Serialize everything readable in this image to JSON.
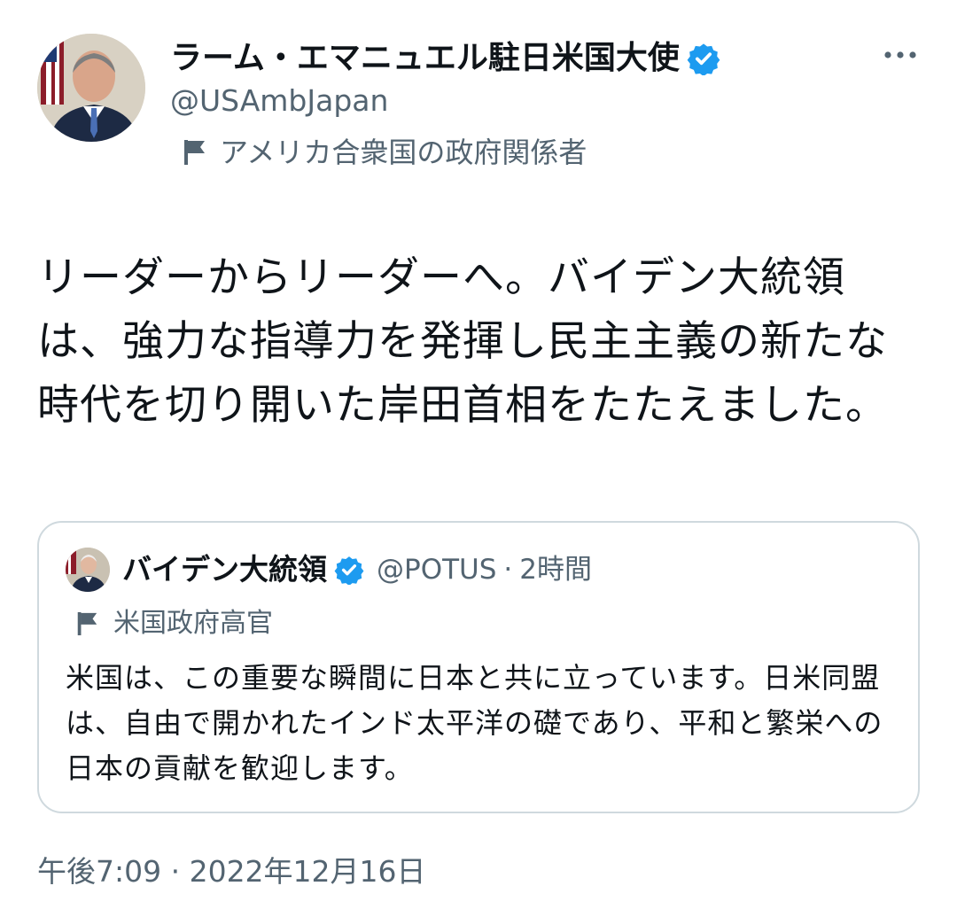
{
  "author": {
    "name": "ラーム・エマニュエル駐日米国大使",
    "handle": "@USAmbJapan",
    "label": "アメリカ合衆国の政府関係者",
    "verified_color": "#1d9bf0"
  },
  "tweet": {
    "text": "リーダーからリーダーへ。バイデン大統領は、強力な指導力を発揮し民主主義の新たな時代を切り開いた岸田首相をたたえました。"
  },
  "quote": {
    "name": "バイデン大統領",
    "handle": "@POTUS",
    "separator": "·",
    "time": "2時間",
    "label": "米国政府高官",
    "text": "米国は、この重要な瞬間に日本と共に立っています。日米同盟は、自由で開かれたインド太平洋の礎であり、平和と繁栄への日本の貢献を歓迎します。"
  },
  "timestamp": "午後7:09 · 2022年12月16日",
  "icons": {
    "more": "more-horizontal-icon",
    "verified": "verified-badge-icon",
    "flag": "government-label-flag-icon"
  }
}
